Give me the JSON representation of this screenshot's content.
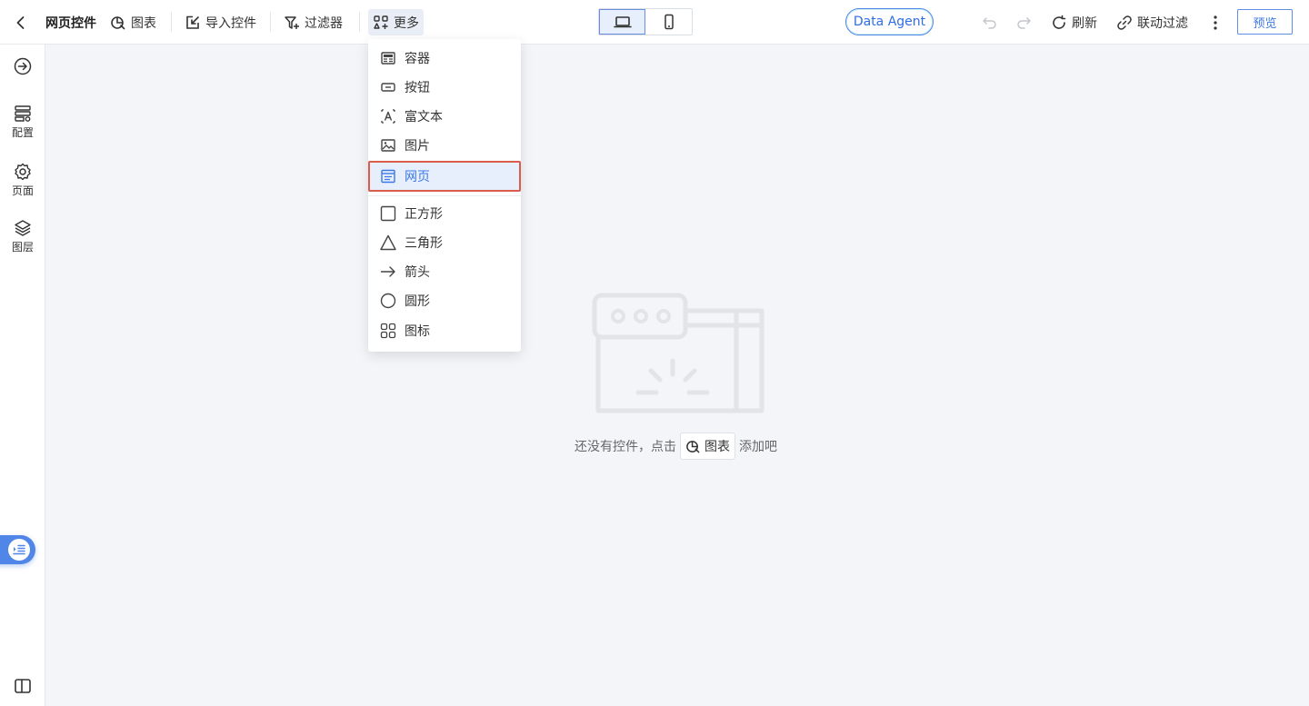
{
  "toolbar": {
    "title": "网页控件",
    "chart_label": "图表",
    "import_label": "导入控件",
    "filter_label": "过滤器",
    "more_label": "更多",
    "agent_label": "Data Agent",
    "refresh_label": "刷新",
    "link_filter_label": "联动过滤",
    "preview_label": "预览"
  },
  "sidebar": {
    "config_label": "配置",
    "page_label": "页面",
    "layer_label": "图层"
  },
  "more_menu": {
    "items": [
      {
        "label": "容器",
        "icon": "container-icon"
      },
      {
        "label": "按钮",
        "icon": "button-icon"
      },
      {
        "label": "富文本",
        "icon": "rich-text-icon"
      },
      {
        "label": "图片",
        "icon": "image-icon"
      },
      {
        "label": "网页",
        "icon": "webpage-icon",
        "selected": true
      },
      {
        "label": "正方形",
        "icon": "square-icon"
      },
      {
        "label": "三角形",
        "icon": "triangle-icon"
      },
      {
        "label": "箭头",
        "icon": "arrow-icon"
      },
      {
        "label": "圆形",
        "icon": "circle-icon"
      },
      {
        "label": "图标",
        "icon": "icon-grid-icon"
      }
    ]
  },
  "empty_state": {
    "text_before": "还没有控件，点击",
    "chip_label": "图表",
    "text_after": "添加吧"
  },
  "colors": {
    "accent": "#3c78e6",
    "highlight_border": "#d95c4e",
    "canvas_bg": "#f3f5f9"
  }
}
